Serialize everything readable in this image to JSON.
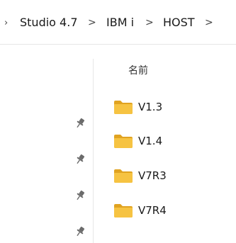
{
  "breadcrumb": {
    "items": [
      "Studio 4.7",
      "IBM i",
      "HOST"
    ],
    "separator": ">"
  },
  "file_list": {
    "column_header": "名前",
    "folders": [
      "V1.3",
      "V1.4",
      "V7R3",
      "V7R4"
    ]
  },
  "quick_access": {
    "pin_icon": "pin-icon",
    "pin_count": 4
  },
  "colors": {
    "folder_yellow": "#f6c342",
    "folder_dark": "#e0a321",
    "divider": "#e6e6e6",
    "pin_gray": "#6b6b6b"
  }
}
